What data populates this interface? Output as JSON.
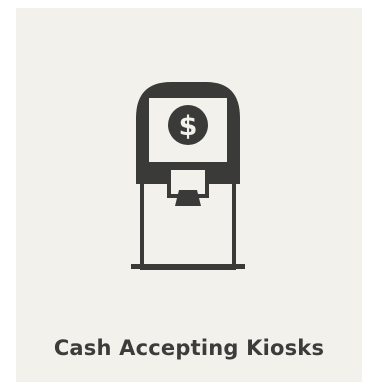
{
  "card": {
    "title": "Cash Accepting Kiosks",
    "icon": "cash-kiosk-icon",
    "glyph": "$"
  },
  "colors": {
    "card_background": "#f2f1ec",
    "icon_dark": "#3a3a38",
    "text": "#3d3c3a"
  }
}
